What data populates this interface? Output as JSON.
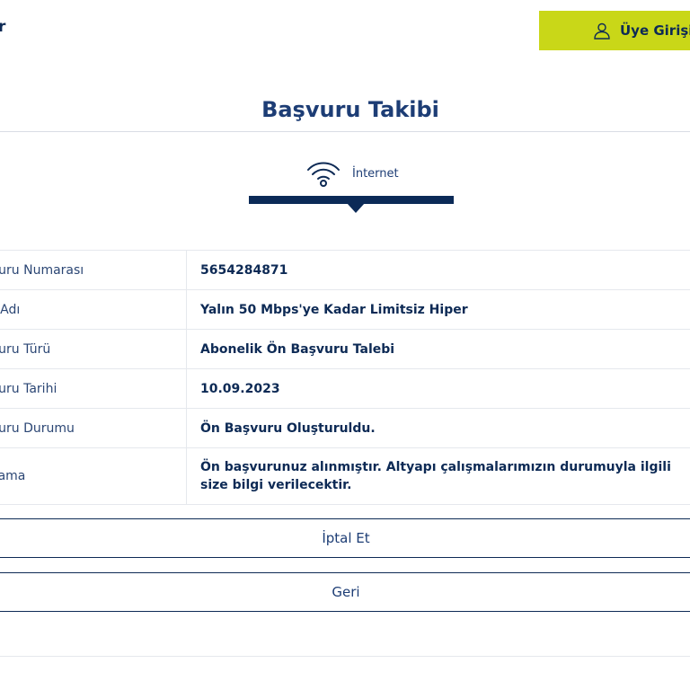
{
  "header": {
    "fragment_text": "r",
    "login_label": "Üye Girişi"
  },
  "page": {
    "title": "Başvuru Takibi"
  },
  "service_tab": {
    "label": "İnternet"
  },
  "details": [
    {
      "label": "aşvuru Numarası",
      "value": "5654284871"
    },
    {
      "label": "ket Adı",
      "value": "Yalın 50 Mbps'ye Kadar Limitsiz Hiper"
    },
    {
      "label": "aşvuru Türü",
      "value": "Abonelik Ön Başvuru Talebi"
    },
    {
      "label": "aşvuru Tarihi",
      "value": "10.09.2023"
    },
    {
      "label": "aşvuru Durumu",
      "value": "Ön Başvuru Oluşturuldu."
    },
    {
      "label": "çıklama",
      "value": "Ön başvurunuz alınmıştır. Altyapı çalışmalarımızın durumuyla ilgili size bilgi verilecektir."
    }
  ],
  "actions": {
    "cancel_label": "İptal Et",
    "back_label": "Geri"
  },
  "colors": {
    "accent": "#c9d718",
    "navy": "#0b2a57"
  }
}
